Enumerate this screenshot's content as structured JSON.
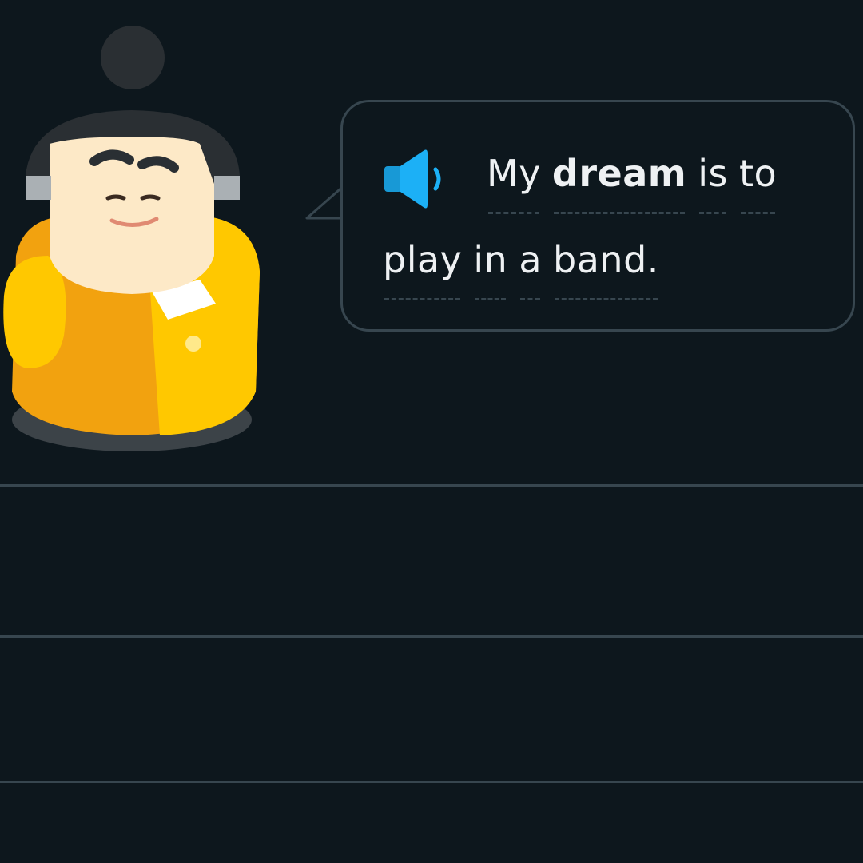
{
  "prompt": {
    "speaker_icon": "speaker-icon",
    "line1": [
      {
        "text": "My",
        "bold": false
      },
      {
        "text": "dream",
        "bold": true
      },
      {
        "text": "is",
        "bold": false
      },
      {
        "text": "to",
        "bold": false
      }
    ],
    "line2": [
      {
        "text": "play",
        "bold": false
      },
      {
        "text": "in",
        "bold": false
      },
      {
        "text": "a",
        "bold": false
      },
      {
        "text": "band.",
        "bold": false
      }
    ]
  },
  "colors": {
    "background": "#0d171d",
    "bubble_border": "#37464f",
    "text": "#eef1f3",
    "speaker_blue": "#1cb0f6",
    "character_yellow": "#ffc800"
  },
  "answer_area": {
    "lines": 3
  }
}
